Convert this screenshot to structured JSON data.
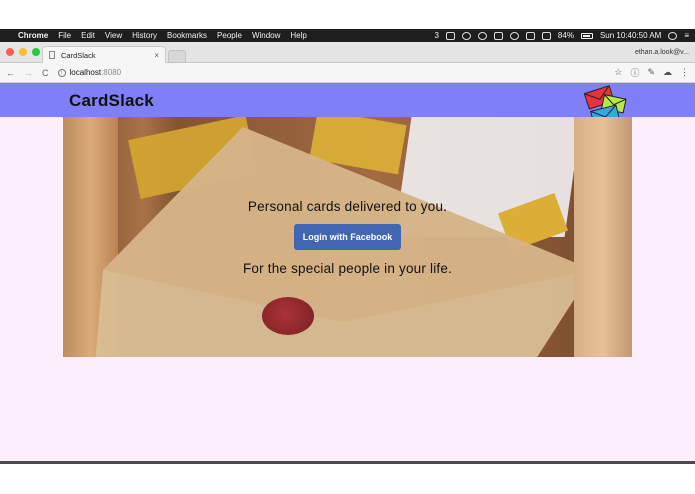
{
  "menubar": {
    "app_name": "Chrome",
    "menus": [
      "File",
      "Edit",
      "View",
      "History",
      "Bookmarks",
      "People",
      "Window",
      "Help"
    ],
    "status_count": "3",
    "battery": "84%",
    "clock": "Sun 10:40:50 AM"
  },
  "browser": {
    "tab_title": "CardSlack",
    "tab_close": "×",
    "profile_name": "ethan.a.look@v...",
    "url_host": "localhost",
    "url_port": ":8080",
    "back": "←",
    "forward": "→",
    "reload": "C"
  },
  "page": {
    "brand": "CardSlack",
    "tagline_top": "Personal cards delivered to you.",
    "login_button": "Login with Facebook",
    "tagline_bottom": "For the special people in your life."
  },
  "colors": {
    "header": "#7f7ff8",
    "page_background": "#fdeefe",
    "facebook_button": "#4266b2"
  }
}
